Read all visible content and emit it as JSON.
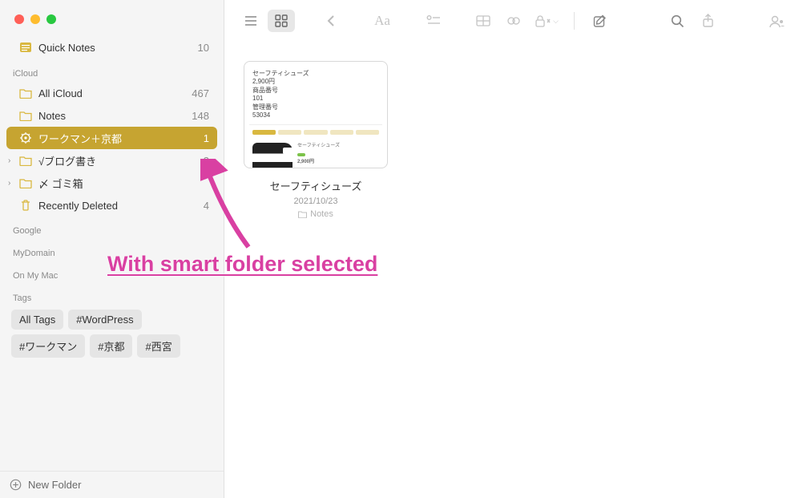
{
  "sidebar": {
    "quick": {
      "label": "Quick Notes",
      "count": "10"
    },
    "sections": {
      "icloud": {
        "header": "iCloud",
        "items": [
          {
            "label": "All iCloud",
            "count": "467"
          },
          {
            "label": "Notes",
            "count": "148"
          },
          {
            "label": "ワークマン＋京都",
            "count": "1"
          },
          {
            "label": "√ブログ書き",
            "count": "3"
          },
          {
            "label": "〆 ゴミ箱",
            "count": ""
          },
          {
            "label": "Recently Deleted",
            "count": "4"
          }
        ]
      },
      "google": {
        "header": "Google"
      },
      "mydomain": {
        "header": "MyDomain"
      },
      "onmymac": {
        "header": "On My Mac"
      },
      "tags": {
        "header": "Tags",
        "items": [
          "All Tags",
          "#WordPress",
          "#ワークマン",
          "#京都",
          "#西宮"
        ]
      }
    },
    "footer": {
      "label": "New Folder"
    }
  },
  "content": {
    "notes": [
      {
        "title": "セーフティシューズ",
        "date": "2021/10/23",
        "folder": "Notes",
        "thumb": {
          "line1": "セーフティシューズ",
          "line2": "2,900円",
          "line3": "商品番号",
          "line4": "101",
          "line5": "管理番号",
          "line6": "53034",
          "prodname": "セーフティシューズ",
          "prodprice": "2,900円"
        }
      }
    ]
  },
  "annotation": {
    "text": "With smart folder selected"
  }
}
